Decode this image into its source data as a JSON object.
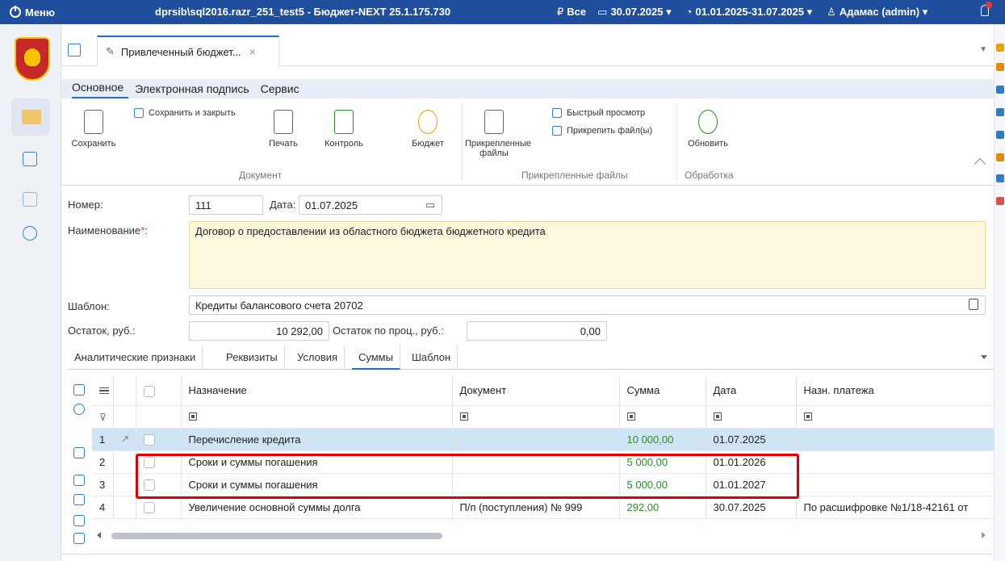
{
  "topbar": {
    "menu_label": "Меню",
    "title": "dprsib\\sql2016.razr_251_test5 - Бюджет-NEXT 25.1.175.730",
    "currency": "Все",
    "date": "30.07.2025",
    "period": "01.01.2025-31.07.2025",
    "user": "Адамас (admin)"
  },
  "doc_tab": {
    "title": "Привлеченный бюджет..."
  },
  "ribbon_menu": [
    "Основное",
    "Электронная подпись",
    "Сервис"
  ],
  "ribbon": {
    "save": "Сохранить",
    "save_close": "Сохранить и закрыть",
    "print": "Печать",
    "control": "Контроль",
    "budget": "Бюджет",
    "attached": "Прикрепленные файлы",
    "quick_view": "Быстрый просмотр",
    "attach_file": "Прикрепить файл(ы)",
    "refresh": "Обновить",
    "group_document": "Документ",
    "group_files": "Прикрепленные файлы",
    "group_processing": "Обработка"
  },
  "form": {
    "number_label": "Номер:",
    "number_value": "111",
    "date_label": "Дата:",
    "date_value": "01.07.2025",
    "name_label": "Наименование",
    "name_req": "*",
    "name_colon": ":",
    "name_value": "Договор о предоставлении из областного бюджета бюджетного кредита",
    "template_label": "Шаблон:",
    "template_value": "Кредиты балансового счета 20702",
    "balance_label": "Остаток, руб.:",
    "balance_value": "10 292,00",
    "pct_balance_label": "Остаток по проц., руб.:",
    "pct_balance_value": "0,00"
  },
  "lower_tabs": [
    "Аналитические признаки",
    "Реквизиты",
    "Условия",
    "Суммы",
    "Шаблон"
  ],
  "table": {
    "headers": [
      "Назначение",
      "Документ",
      "Сумма",
      "Дата",
      "Назн. платежа"
    ],
    "rows": [
      {
        "n": "1",
        "purpose": "Перечисление кредита",
        "doc": "",
        "sum": "10 000,00",
        "date": "01.07.2025",
        "pay": ""
      },
      {
        "n": "2",
        "purpose": "Сроки и суммы погашения",
        "doc": "",
        "sum": "5 000,00",
        "date": "01.01.2026",
        "pay": ""
      },
      {
        "n": "3",
        "purpose": "Сроки и суммы погашения",
        "doc": "",
        "sum": "5 000,00",
        "date": "01.01.2027",
        "pay": ""
      },
      {
        "n": "4",
        "purpose": "Увеличение основной суммы долга",
        "doc": "П/п (поступления) № 999",
        "sum": "292,00",
        "date": "30.07.2025",
        "pay": "По расшифровке №1/18-42161 от"
      }
    ]
  },
  "colors": {
    "topbar": "#1f4f9c",
    "accent": "#1f6fd0",
    "selected_row": "#cfe5f5",
    "required": "#fbf8dd",
    "highlight": "#e10000",
    "sum_green": "#2e8b2e"
  }
}
